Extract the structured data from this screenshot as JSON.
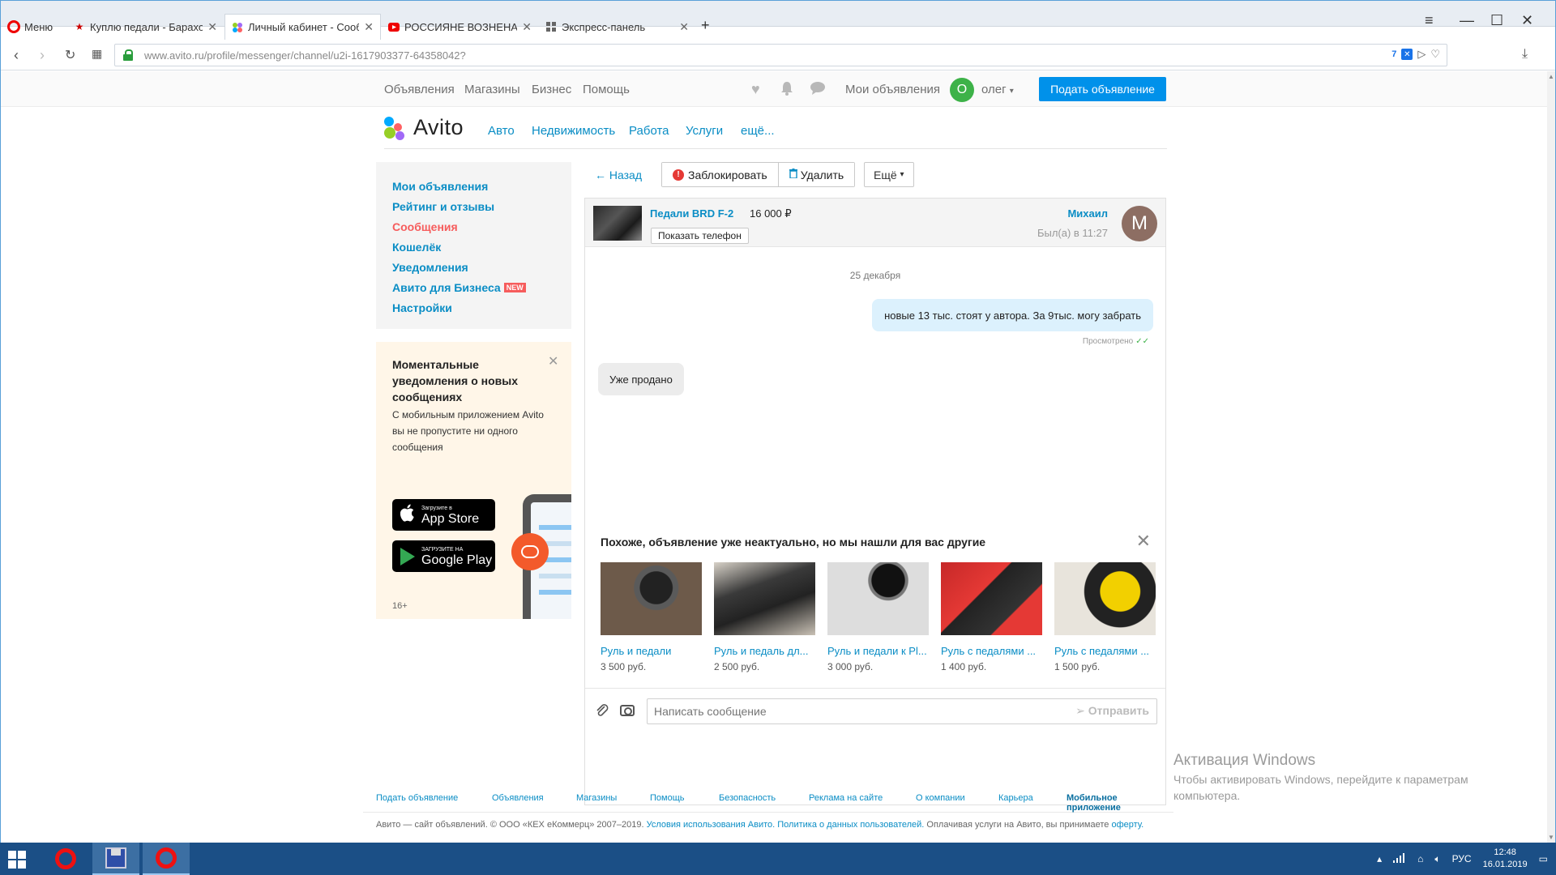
{
  "browser": {
    "menu_label": "Меню",
    "tabs": [
      {
        "label": "Куплю педали - Барахолка",
        "icon": "star-icon"
      },
      {
        "label": "Личный кабинет - Сообщ",
        "icon": "avito-icon"
      },
      {
        "label": "РОССИЯНЕ ВОЗНЕНАВИД",
        "icon": "youtube-icon"
      },
      {
        "label": "Экспресс-панель",
        "icon": "grid-icon"
      }
    ],
    "url": "www.avito.ru/profile/messenger/channel/u2i-1617903377-64358042?",
    "badge_count": "7"
  },
  "topnav": {
    "links": [
      "Объявления",
      "Магазины",
      "Бизнес",
      "Помощь"
    ],
    "my_ads": "Мои объявления",
    "user_initial": "О",
    "user_name": "олег",
    "post_button": "Подать объявление"
  },
  "brand": {
    "logo_text": "Avito",
    "categories": [
      "Авто",
      "Недвижимость",
      "Работа",
      "Услуги",
      "ещё..."
    ]
  },
  "sidebar": {
    "items": [
      "Мои объявления",
      "Рейтинг и отзывы",
      "Сообщения",
      "Кошелёк",
      "Уведомления",
      "Авито для Бизнеса",
      "Настройки"
    ],
    "new_badge": "NEW"
  },
  "promo": {
    "title": "Моментальные уведомления о новых сообщениях",
    "text": "С мобильным приложением Avito вы не пропустите ни одного сообщения",
    "appstore_small": "Загрузите в",
    "appstore_large": "App Store",
    "googleplay_small": "ЗАГРУЗИТЕ НА",
    "googleplay_large": "Google Play",
    "age": "16+"
  },
  "actions": {
    "back": "← Назад",
    "block": "Заблокировать",
    "delete": "Удалить",
    "more": "Ещё"
  },
  "chat": {
    "item_title": "Педали BRD F-2",
    "item_price": "16 000 ₽",
    "show_phone": "Показать телефон",
    "seller_name": "Михаил",
    "seller_seen": "Был(а) в 11:27",
    "seller_initial": "М",
    "date": "25 декабря",
    "messages": [
      {
        "dir": "out",
        "text": "новые 13 тыс. стоят у автора. За 9тыс. могу забрать",
        "status": "Просмотрено"
      },
      {
        "dir": "in",
        "text": "Уже продано"
      }
    ],
    "similar_title": "Похоже, объявление уже неактуально, но мы нашли для вас другие",
    "similar": [
      {
        "name": "Руль и педали",
        "price": "3 500 руб."
      },
      {
        "name": "Руль и педаль дл...",
        "price": "2 500 руб."
      },
      {
        "name": "Руль и педали к Pl...",
        "price": "3 000 руб."
      },
      {
        "name": "Руль с педалями ...",
        "price": "1 400 руб."
      },
      {
        "name": "Руль с педалями ...",
        "price": "1 500 руб."
      }
    ],
    "input_placeholder": "Написать сообщение",
    "send": "Отправить"
  },
  "footer": {
    "links": [
      "Подать объявление",
      "Объявления",
      "Магазины",
      "Помощь",
      "Безопасность",
      "Реклама на сайте",
      "О компании",
      "Карьера",
      "Мобильное приложение"
    ],
    "copy_prefix": "Авито — сайт объявлений. © ООО «КЕХ еКоммерц» 2007–2019.",
    "terms": "Условия использования Авито.",
    "privacy": "Политика о данных пользователей.",
    "pay_text": "Оплачивая услуги на Авито, вы принимаете",
    "offer": "оферту."
  },
  "windows": {
    "activate_title": "Активация Windows",
    "activate_text": "Чтобы активировать Windows, перейдите к параметрам компьютера.",
    "lang": "РУС",
    "time": "12:48",
    "date": "16.01.2019"
  }
}
